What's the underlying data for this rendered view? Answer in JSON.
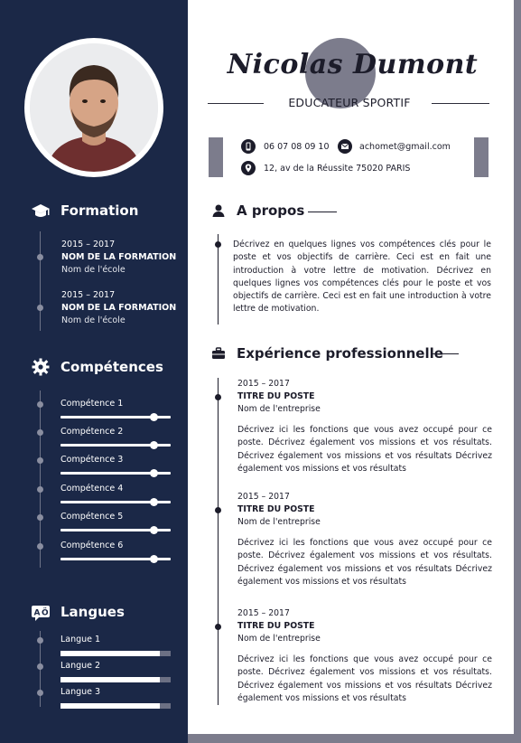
{
  "header": {
    "name": "Nicolas Dumont",
    "job_title": "EDUCATEUR SPORTIF",
    "phone": "06 07 08 09 10",
    "email": "achomet@gmail.com",
    "address": "12, av de la Réussite 75020 PARIS"
  },
  "sidebar": {
    "formation": {
      "title": "Formation",
      "items": [
        {
          "years": "2015 – 2017",
          "degree": "NOM DE LA FORMATION",
          "school": "Nom de l'école"
        },
        {
          "years": "2015 – 2017",
          "degree": "NOM DE LA FORMATION",
          "school": "Nom de l'école"
        }
      ]
    },
    "competences": {
      "title": "Compétences",
      "items": [
        {
          "label": "Compétence 1",
          "level": 0.85
        },
        {
          "label": "Compétence 2",
          "level": 0.85
        },
        {
          "label": "Compétence 3",
          "level": 0.85
        },
        {
          "label": "Compétence 4",
          "level": 0.85
        },
        {
          "label": "Compétence 5",
          "level": 0.85
        },
        {
          "label": "Compétence 6",
          "level": 0.85
        }
      ]
    },
    "langues": {
      "title": "Langues",
      "items": [
        {
          "label": "Langue 1",
          "level": 0.9
        },
        {
          "label": "Langue 2",
          "level": 0.9
        },
        {
          "label": "Langue 3",
          "level": 0.9
        }
      ]
    }
  },
  "main": {
    "about": {
      "title": "A propos",
      "text": "Décrivez en quelques lignes vos compétences clés pour le poste et vos objectifs de carrière. Ceci est en fait une introduction à votre lettre de motivation. Décrivez en quelques lignes vos compétences clés pour le poste et vos objectifs de carrière. Ceci est en fait une introduction à votre lettre de motivation."
    },
    "experience": {
      "title": "Expérience professionnelle",
      "items": [
        {
          "years": "2015 – 2017",
          "position": "TITRE DU POSTE",
          "company": "Nom de l'entreprise",
          "description": "Décrivez ici les fonctions que vous avez occupé pour ce poste. Décrivez également vos missions et vos résultats. Décrivez également vos missions et vos résultats Décrivez également vos missions et vos résultats"
        },
        {
          "years": "2015 – 2017",
          "position": "TITRE DU POSTE",
          "company": "Nom de l'entreprise",
          "description": "Décrivez ici les fonctions que vous avez occupé pour ce poste. Décrivez également vos missions et vos résultats. Décrivez également vos missions et vos résultats Décrivez également vos missions et vos résultats"
        },
        {
          "years": "2015 – 2017",
          "position": "TITRE DU POSTE",
          "company": "Nom de l'entreprise",
          "description": "Décrivez ici les fonctions que vous avez occupé pour ce poste. Décrivez également vos missions et vos résultats. Décrivez également vos missions et vos résultats Décrivez également vos missions et vos résultats"
        }
      ]
    }
  },
  "colors": {
    "sidebar": "#1b2847",
    "accent_gray": "#7c7c8c",
    "text_dark": "#1c1c2a"
  },
  "icons": {
    "formation": "graduation-cap-icon",
    "competences": "gear-icon",
    "langues": "language-icon",
    "about": "user-icon",
    "experience": "briefcase-icon",
    "phone": "phone-icon",
    "email": "envelope-icon",
    "address": "location-pin-icon"
  }
}
